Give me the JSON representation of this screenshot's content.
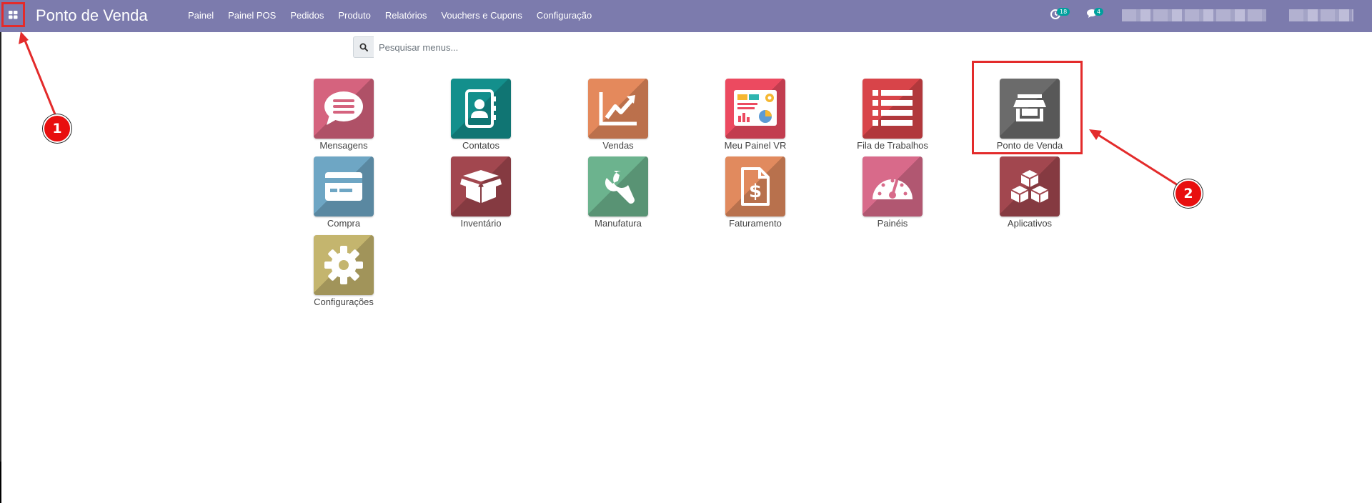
{
  "navbar": {
    "app_title": "Ponto de Venda",
    "menu": [
      "Painel",
      "Painel POS",
      "Pedidos",
      "Produto",
      "Relatórios",
      "Vouchers e Cupons",
      "Configuração"
    ],
    "activity_count": "18",
    "messages_count": "4"
  },
  "search": {
    "placeholder": "Pesquisar menus..."
  },
  "apps": [
    {
      "label": "Mensagens",
      "icon": "chat-icon",
      "color": "#d5637e"
    },
    {
      "label": "Contatos",
      "icon": "address-book-icon",
      "color": "#138f8c"
    },
    {
      "label": "Vendas",
      "icon": "trend-chart-icon",
      "color": "#e4895c"
    },
    {
      "label": "Meu Painel VR",
      "icon": "dashboard-report-icon",
      "color": "#ec4a60"
    },
    {
      "label": "Fila de Trabalhos",
      "icon": "list-icon",
      "color": "#d84449"
    },
    {
      "label": "Ponto de Venda",
      "icon": "store-icon",
      "color": "#6b6b6b"
    },
    {
      "label": "Compra",
      "icon": "credit-card-icon",
      "color": "#6ea6c4"
    },
    {
      "label": "Inventário",
      "icon": "open-box-icon",
      "color": "#a2474f"
    },
    {
      "label": "Manufatura",
      "icon": "wrench-icon",
      "color": "#6cb38e"
    },
    {
      "label": "Faturamento",
      "icon": "invoice-dollar-icon",
      "color": "#e18a5e"
    },
    {
      "label": "Painéis",
      "icon": "gauge-icon",
      "color": "#d86a8a"
    },
    {
      "label": "Aplicativos",
      "icon": "cubes-icon",
      "color": "#a2474f"
    },
    {
      "label": "Configurações",
      "icon": "gear-icon",
      "color": "#c4b56e"
    }
  ],
  "annotations": {
    "marker_1": "1",
    "marker_2": "2",
    "color": "#e32b2b"
  }
}
